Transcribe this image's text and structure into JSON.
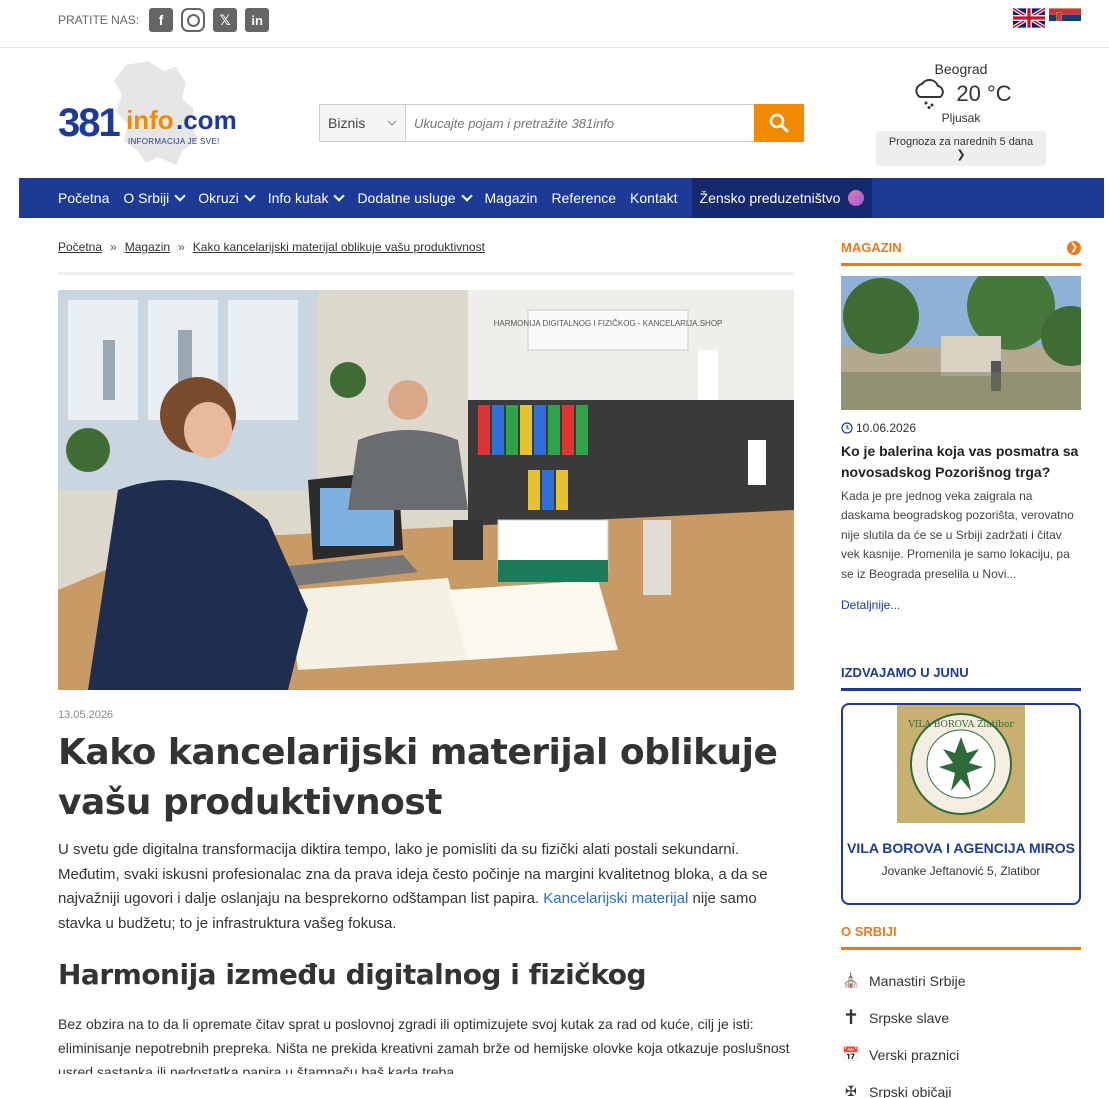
{
  "top": {
    "follow_label": "PRATITE NAS:",
    "social": [
      {
        "name": "facebook-icon",
        "glyph": "f"
      },
      {
        "name": "instagram-icon",
        "glyph": ""
      },
      {
        "name": "x-twitter-icon",
        "glyph": "𝕏"
      },
      {
        "name": "linkedin-icon",
        "glyph": "in"
      }
    ],
    "flags": [
      "english-flag-icon",
      "serbian-flag-icon"
    ]
  },
  "logo": {
    "num": "381",
    "info": "info",
    "com": ".com",
    "sub": "INFORMACIJA JE SVE!"
  },
  "search": {
    "category": "Biznis",
    "placeholder": "Ukucajte pojam i pretražite 381info"
  },
  "weather": {
    "city": "Beograd",
    "temp": "20 °C",
    "desc": "Pljusak",
    "forecast_btn": "Prognoza za narednih 5 dana ❯"
  },
  "nav": {
    "items": [
      {
        "label": "Početna",
        "dropdown": false
      },
      {
        "label": "O Srbiji",
        "dropdown": true
      },
      {
        "label": "Okruzi",
        "dropdown": true
      },
      {
        "label": "Info kutak",
        "dropdown": true
      },
      {
        "label": "Dodatne usluge",
        "dropdown": true
      },
      {
        "label": "Magazin",
        "dropdown": false
      },
      {
        "label": "Reference",
        "dropdown": false
      },
      {
        "label": "Kontakt",
        "dropdown": false
      }
    ],
    "special": "Žensko preduzetništvo"
  },
  "breadcrumb": {
    "home": "Početna",
    "sep": "»",
    "section": "Magazin",
    "current": "Kako kancelarijski materijal oblikuje vašu produktivnost"
  },
  "article": {
    "hero_sign": "HARMONIJA DIGITALNOG I FIZIČKOG - KANCELARIJA.SHOP",
    "date": "13.05.2026",
    "title": "Kako kancelarijski materijal oblikuje vašu produktivnost",
    "intro_text": "U svetu gde digitalna transformacija diktira tempo, lako je pomisliti da su fizički alati postali sekundarni. Međutim, svaki iskusni profesionalac zna da prava ideja često počinje na margini kvalitetnog bloka, a da se najvažniji ugovori i dalje oslanjaju na besprekorno odštampan list papira.",
    "intro_link": "Kancelarijski materijal",
    "intro_after": " nije samo stavka u budžetu; to je infrastruktura vašeg fokusa.",
    "h2": "Harmonija između digitalnog i fizičkog",
    "p2": "Bez obzira na to da li opremate čitav sprat u poslovnoj zgradi ili optimizujete svoj kutak za rad od kuće, cilj je isti: eliminisanje nepotrebnih prepreka. Ništa ne prekida kreativni zamah brže od hemijske olovke koja otkazuje poslušnost usred sastanka ili nedostatka papira u štampaču baš kada treba"
  },
  "sidebar": {
    "magazin": {
      "heading": "MAGAZIN",
      "date": "10.06.2026",
      "title": "Ko je balerina koja vas posmatra sa novosadskog Pozorišnog trga?",
      "text": "Kada je pre jednog veka zaigrala na daskama beogradskog pozorišta, verovatno nije slutila da će se u Srbiji zadržati i čitav vek kasnije. Promenila je samo lokaciju, pa se iz Beograda preselila u Novi...",
      "more": "Detaljnije..."
    },
    "featured": {
      "heading": "IZDVAJAMO U JUNU",
      "logo_text": "VILA BOROVA Zlatibor",
      "title": "VILA BOROVA I AGENCIJA MIROS",
      "address": "Jovanke Jeftanović 5, Zlatibor"
    },
    "o_srbiji": {
      "heading": "O SRBIJI",
      "items": [
        {
          "label": "Manastiri Srbije",
          "icon": "monastery-icon",
          "glyph": "⛪"
        },
        {
          "label": "Srpske slave",
          "icon": "cross-icon",
          "glyph": "✝"
        },
        {
          "label": "Verski praznici",
          "icon": "calendar-icon",
          "glyph": "📅"
        },
        {
          "label": "Srpski običaji",
          "icon": "serbian-cross-icon",
          "glyph": "✠"
        }
      ]
    }
  },
  "colors": {
    "brand_blue": "#1d3a96",
    "accent_orange": "#f08a00",
    "link_blue": "#2a6bd6"
  }
}
